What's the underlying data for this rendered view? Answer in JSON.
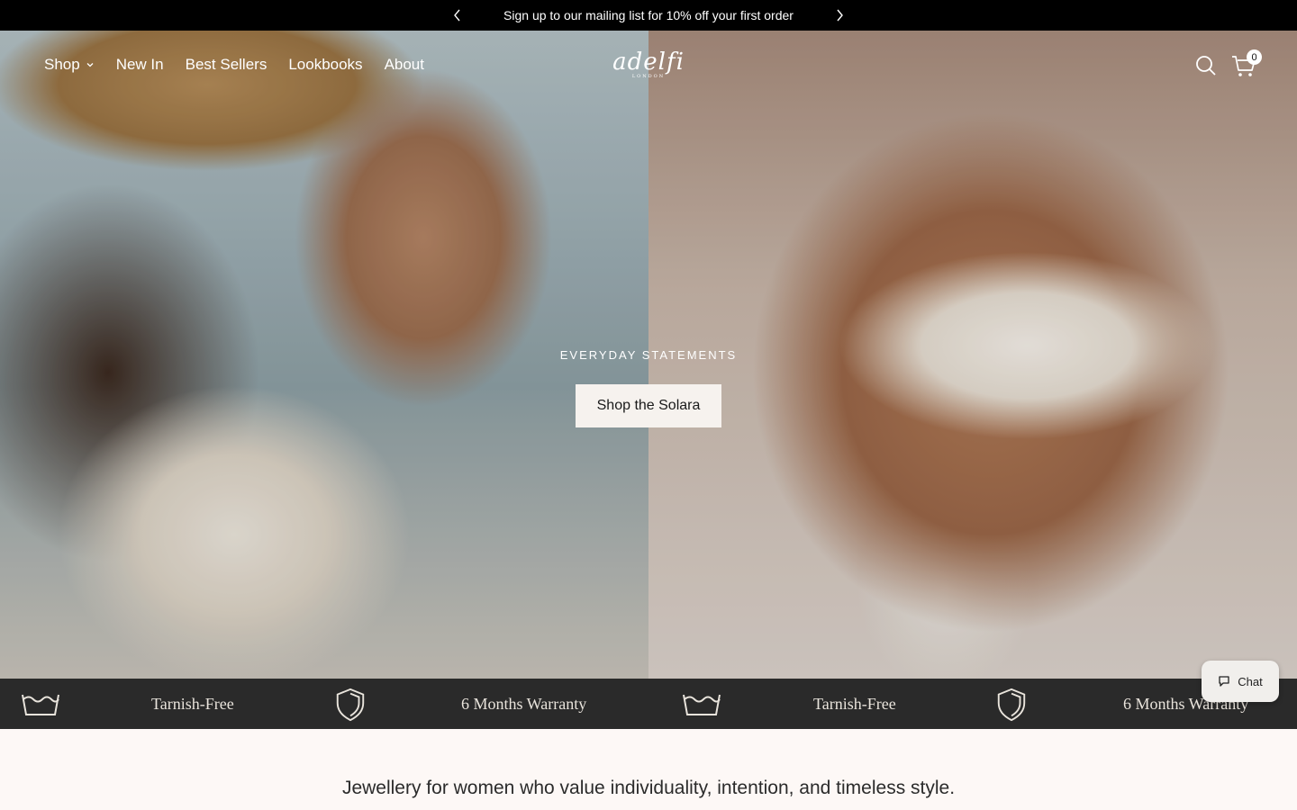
{
  "announcement": {
    "text": "Sign up to our mailing list for 10% off your first order",
    "prev_icon": "chevron-left-icon",
    "next_icon": "chevron-right-icon"
  },
  "nav": {
    "items": [
      {
        "label": "Shop",
        "has_dropdown": true
      },
      {
        "label": "New In"
      },
      {
        "label": "Best Sellers"
      },
      {
        "label": "Lookbooks"
      },
      {
        "label": "About"
      }
    ],
    "logo": "adelfi",
    "logo_sub": "LONDON",
    "cart_count": "0",
    "search_icon": "search-icon",
    "cart_icon": "shopping-cart-icon"
  },
  "hero": {
    "eyebrow": "EVERYDAY STATEMENTS",
    "button_label": "Shop the Solara"
  },
  "features": [
    {
      "icon": "washing-basin-icon",
      "label": "Tarnish-Free"
    },
    {
      "icon": "shield-icon",
      "label": "6 Months Warranty"
    },
    {
      "icon": "washing-basin-icon",
      "label": "Tarnish-Free"
    },
    {
      "icon": "shield-icon",
      "label": "6 Months Warranty"
    }
  ],
  "chat": {
    "label": "Chat",
    "icon": "chat-bubble-icon"
  },
  "tagline": "Jewellery for women who value individuality, intention, and timeless style.",
  "colors": {
    "announcement_bg": "#000000",
    "features_bg": "#2a2a2a",
    "page_bg": "#fdf8f6"
  }
}
